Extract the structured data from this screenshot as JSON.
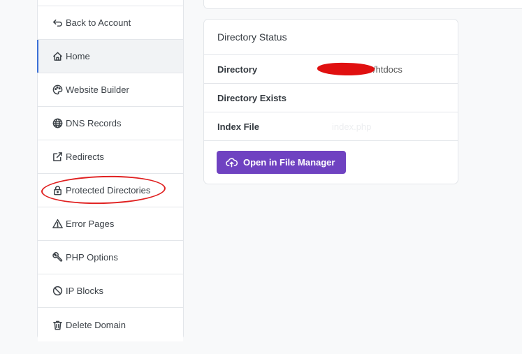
{
  "sidebar": {
    "items": [
      {
        "label": "Back to Account",
        "icon": "back-arrow-icon"
      },
      {
        "label": "Home",
        "icon": "home-icon",
        "active": true
      },
      {
        "label": "Website Builder",
        "icon": "palette-icon"
      },
      {
        "label": "DNS Records",
        "icon": "globe-icon"
      },
      {
        "label": "Redirects",
        "icon": "external-link-icon"
      },
      {
        "label": "Protected Directories",
        "icon": "lock-icon"
      },
      {
        "label": "Error Pages",
        "icon": "warning-icon"
      },
      {
        "label": "PHP Options",
        "icon": "tools-icon"
      },
      {
        "label": "IP Blocks",
        "icon": "block-icon"
      },
      {
        "label": "Delete Domain",
        "icon": "trash-icon"
      }
    ]
  },
  "status_card": {
    "title": "Directory Status",
    "rows": [
      {
        "label": "Directory",
        "value": "/htdocs"
      },
      {
        "label": "Directory Exists",
        "value": ""
      },
      {
        "label": "Index File",
        "value": "index.php"
      }
    ],
    "button_label": "Open in File Manager"
  },
  "colors": {
    "accent": "#6f42c1",
    "active_indicator": "#3b6fd6",
    "annotation": "#e02020"
  }
}
